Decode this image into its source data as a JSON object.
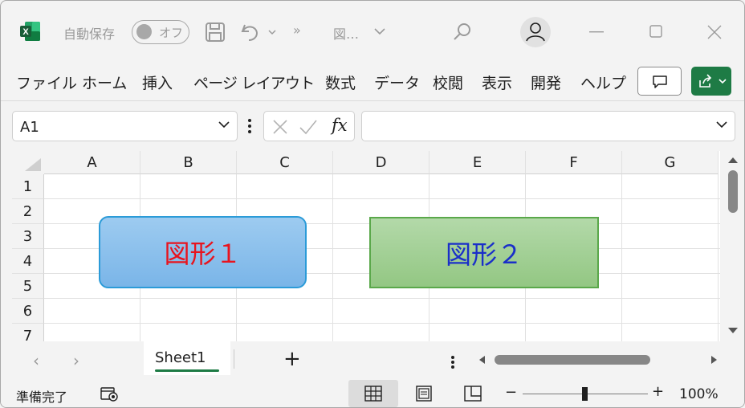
{
  "titlebar": {
    "autosave_label": "自動保存",
    "autosave_state": "オフ",
    "more_label": "»",
    "doc_title": "図…",
    "icons": [
      "excel-icon",
      "save-icon",
      "undo-icon",
      "search-icon",
      "profile-icon",
      "minimize-icon",
      "maximize-icon",
      "close-icon"
    ]
  },
  "ribbon": {
    "tabs": [
      "ファイル",
      "ホーム",
      "挿入",
      "ページ レイアウト",
      "数式",
      "データ",
      "校閲",
      "表示",
      "開発",
      "ヘルプ"
    ]
  },
  "formula_bar": {
    "name_box": "A1",
    "fx_label": "fx",
    "formula": ""
  },
  "sheet": {
    "columns": [
      "A",
      "B",
      "C",
      "D",
      "E",
      "F",
      "G"
    ],
    "rows": [
      "1",
      "2",
      "3",
      "4",
      "5",
      "6",
      "7"
    ],
    "shapes": [
      {
        "label": "図形１",
        "fill": "#7ab5e8",
        "border": "#2b9bd8",
        "text_color": "#e8141e",
        "kind": "rounded-rectangle"
      },
      {
        "label": "図形２",
        "fill": "#93c783",
        "border": "#5aa84a",
        "text_color": "#1a2fc9",
        "kind": "rectangle"
      }
    ]
  },
  "tabbar": {
    "prev_label": "‹",
    "next_label": "›",
    "sheet_name": "Sheet1",
    "add_label": "+"
  },
  "statusbar": {
    "status": "準備完了",
    "zoom_minus": "−",
    "zoom_plus": "+",
    "zoom": "100%"
  },
  "colors": {
    "accent": "#1e7b45",
    "background": "#f3f3f3"
  }
}
